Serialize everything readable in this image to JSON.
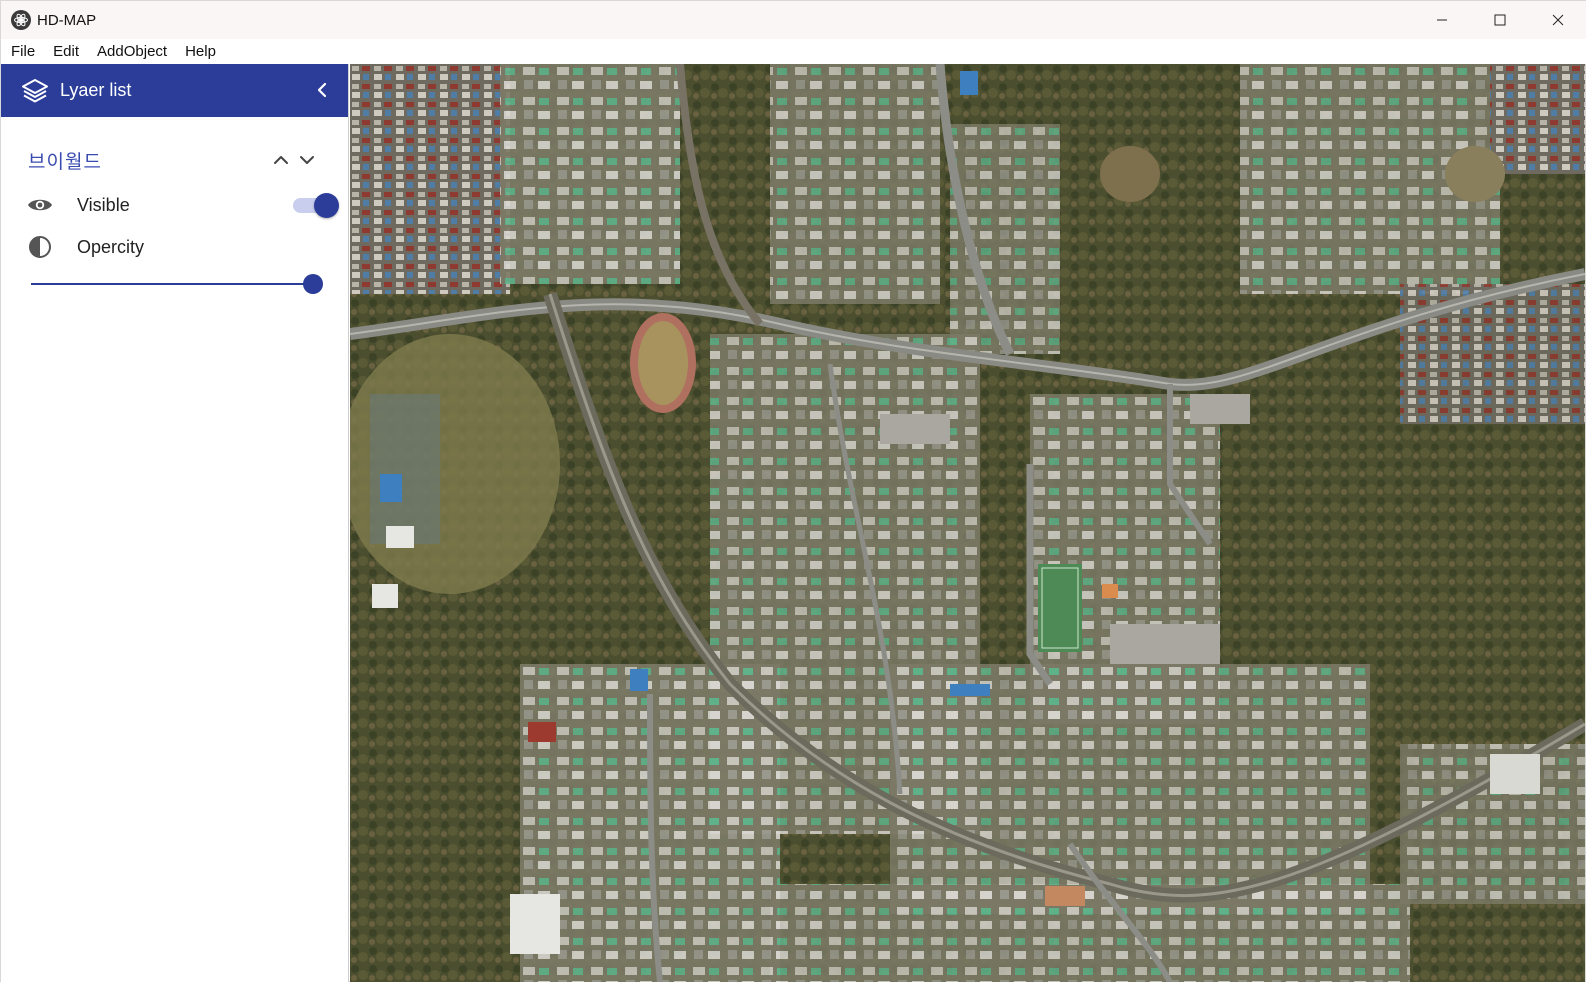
{
  "window": {
    "title": "HD-MAP",
    "controls": [
      "minimize-icon",
      "maximize-icon",
      "close-icon"
    ]
  },
  "menu": {
    "items": [
      "File",
      "Edit",
      "AddObject",
      "Help"
    ]
  },
  "sidebar": {
    "title": "Lyaer list",
    "header_icon": "layers-icon",
    "collapse_icon": "chevron-left-icon",
    "layer": {
      "name": "브이월드",
      "move_up_icon": "chevron-up-icon",
      "move_down_icon": "chevron-down-icon",
      "visible_label": "Visible",
      "visible_icon": "eye-icon",
      "visible": true,
      "opacity_label": "Opercity",
      "opacity_icon": "contrast-icon",
      "opacity_value": 1.0
    }
  },
  "map": {
    "type": "satellite imagery"
  },
  "colors": {
    "accent": "#2b3d99",
    "accent_light": "#c9cdee",
    "layer_name": "#3a4bb0"
  }
}
